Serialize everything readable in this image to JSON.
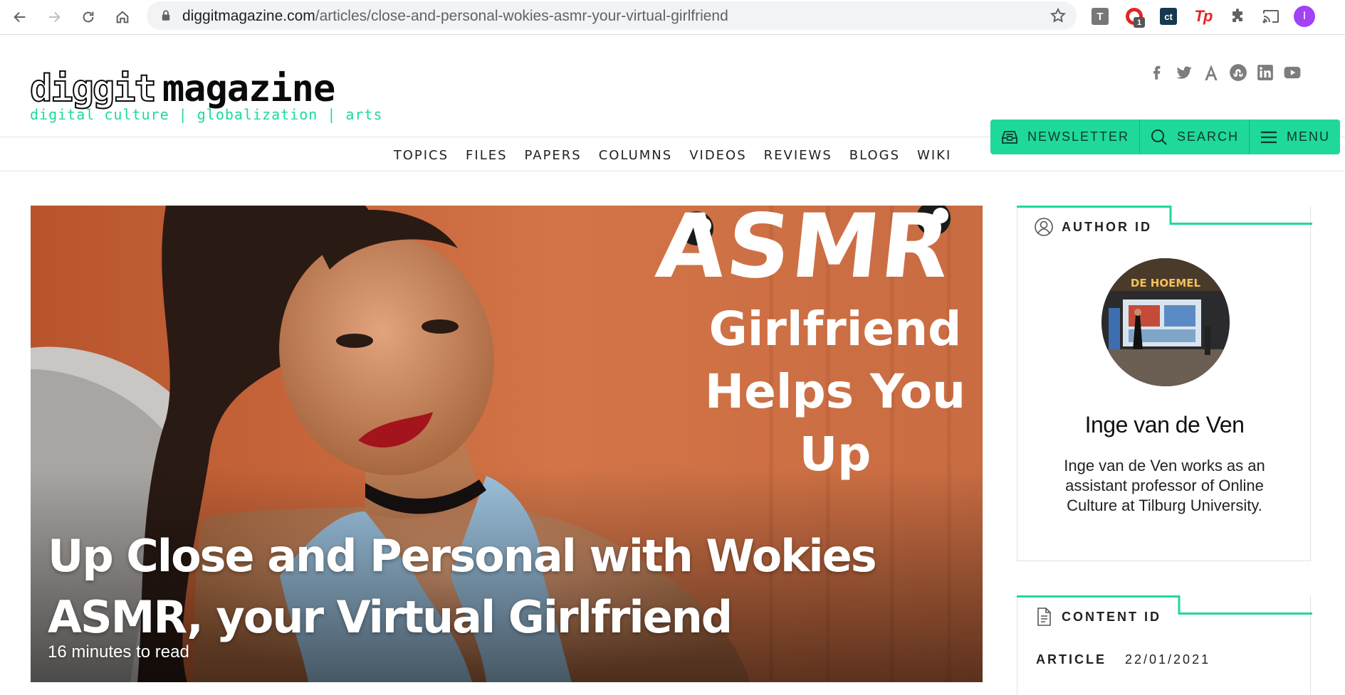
{
  "browser": {
    "url_domain": "diggitmagazine.com",
    "url_path": "/articles/close-and-personal-wokies-asmr-your-virtual-girlfriend",
    "extensions": {
      "t_label": "T",
      "opera_badge": "1",
      "ct_label": "ct",
      "tp_label": "Tp",
      "profile_initial": "I"
    }
  },
  "site": {
    "logo_part1": "diggit",
    "logo_part2": "magazine",
    "tagline": "digital culture | globalization | arts",
    "social_icons": [
      "facebook-icon",
      "twitter-icon",
      "academia-icon",
      "stumbleupon-icon",
      "linkedin-icon",
      "youtube-icon"
    ],
    "nav": [
      "TOPICS",
      "FILES",
      "PAPERS",
      "COLUMNS",
      "VIDEOS",
      "REVIEWS",
      "BLOGS",
      "WIKI"
    ],
    "actions": {
      "newsletter": "NEWSLETTER",
      "search": "SEARCH",
      "menu": "MENU"
    },
    "accent_color": "#1fd99a"
  },
  "hero": {
    "title": "Up Close and Personal with Wokies ASMR, your Virtual Girlfriend",
    "read_time": "16 minutes to read",
    "image_text": {
      "brand": "ASMR",
      "line1": "Girlfriend",
      "line2": "Helps You",
      "line3": "Up"
    }
  },
  "sidebar": {
    "author_card": {
      "heading": "AUTHOR ID",
      "name": "Inge van de Ven",
      "bio": "Inge van de Ven works as an assistant professor of Online Culture at Tilburg University.",
      "photo_sign": "DE HOEMEL"
    },
    "content_card": {
      "heading": "CONTENT ID",
      "type": "ARTICLE",
      "date": "22/01/2021"
    }
  }
}
